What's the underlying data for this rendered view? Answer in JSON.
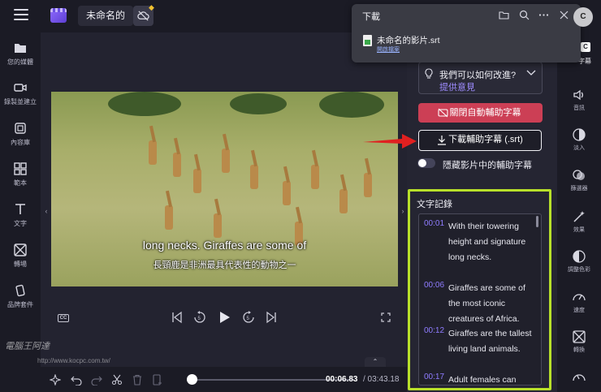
{
  "app": {
    "project_title": "未命名的",
    "premium_icon": "diamond-icon"
  },
  "left_nav": [
    {
      "label": "您的媒體",
      "icon": "folder-icon"
    },
    {
      "label": "錄製並建立",
      "icon": "video-camera-icon"
    },
    {
      "label": "內容庫",
      "icon": "library-icon"
    },
    {
      "label": "範本",
      "icon": "templates-icon"
    },
    {
      "label": "文字",
      "icon": "text-icon"
    },
    {
      "label": "轉場",
      "icon": "transitions-icon"
    },
    {
      "label": "品牌套件",
      "icon": "brand-kit-icon"
    }
  ],
  "video": {
    "caption_en": "long necks. Giraffes are some of",
    "caption_zh": "長頸鹿是非洲最具代表性的動物之一"
  },
  "player": {
    "cc_label": "CC"
  },
  "timeline": {
    "current_time": "00:06.83",
    "total_time": "/ 03:43.18"
  },
  "download_popup": {
    "title": "下載",
    "file_name": "未命名的影片.srt",
    "open_file": "開啟檔案"
  },
  "profile_badge": "C",
  "right_panel": {
    "feedback_question": "我們可以如何改進?",
    "feedback_link": "提供意見",
    "close_captions_button": "關閉自動輔助字幕",
    "download_captions_button": "下載輔助字幕 (.srt)",
    "hide_captions_label": "隱藏影片中的輔助字幕",
    "transcript_title": "文字記錄",
    "transcript": [
      {
        "time": "00:01",
        "text": "With their towering height and signature long necks."
      },
      {
        "time": "00:06",
        "text": "Giraffes are some of the most iconic creatures of Africa."
      },
      {
        "time": "00:12",
        "text": "Giraffes are the tallest living land animals."
      },
      {
        "time": "00:17",
        "text": "Adult females can"
      }
    ]
  },
  "right_rail": [
    {
      "label": "字幕",
      "icon": "captions-icon"
    },
    {
      "label": "音訊",
      "icon": "speaker-icon"
    },
    {
      "label": "淡入",
      "icon": "fade-icon"
    },
    {
      "label": "篩選器",
      "icon": "filters-icon"
    },
    {
      "label": "效果",
      "icon": "effects-wand-icon"
    },
    {
      "label": "調整色彩",
      "icon": "color-adjust-icon"
    },
    {
      "label": "速度",
      "icon": "speed-gauge-icon"
    },
    {
      "label": "轉換",
      "icon": "transition-icon"
    }
  ],
  "watermark": {
    "text": "電腦王阿達",
    "url": "http://www.kocpc.com.tw/"
  },
  "colors": {
    "accent_purple": "#8f7cff",
    "close_button_red": "#cc3f55",
    "highlight_frame": "#b8e02a",
    "annotation_arrow": "#e02020"
  }
}
